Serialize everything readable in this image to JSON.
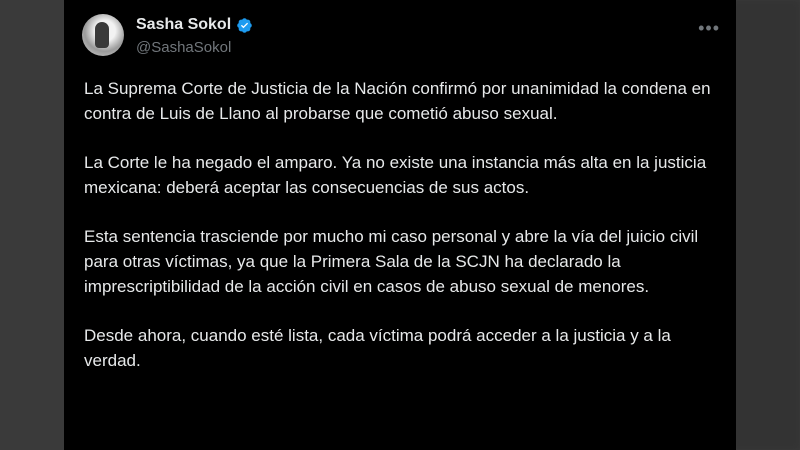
{
  "tweet": {
    "display_name": "Sasha Sokol",
    "handle": "@SashaSokol",
    "verified_icon": "verified-badge-icon",
    "more_icon": "more-options-icon",
    "paragraphs": [
      "La Suprema Corte de Justicia de la Nación confirmó por unanimidad la condena en contra de Luis de Llano al probarse que cometió abuso sexual.",
      "La Corte le ha negado el amparo. Ya no existe una instancia más alta en la justicia mexicana: deberá aceptar las consecuencias de sus actos.",
      "Esta sentencia trasciende por mucho mi caso personal y abre la vía del juicio civil para otras víctimas, ya que la Primera Sala de la SCJN ha declarado la imprescriptibilidad de la acción civil en casos de abuso sexual de menores.",
      "Desde ahora, cuando esté lista, cada víctima podrá acceder a la justicia y a la verdad."
    ]
  },
  "colors": {
    "card_background": "#000000",
    "text_primary": "#e7e9ea",
    "text_secondary": "#71767b",
    "verified_blue": "#1d9bf0"
  }
}
